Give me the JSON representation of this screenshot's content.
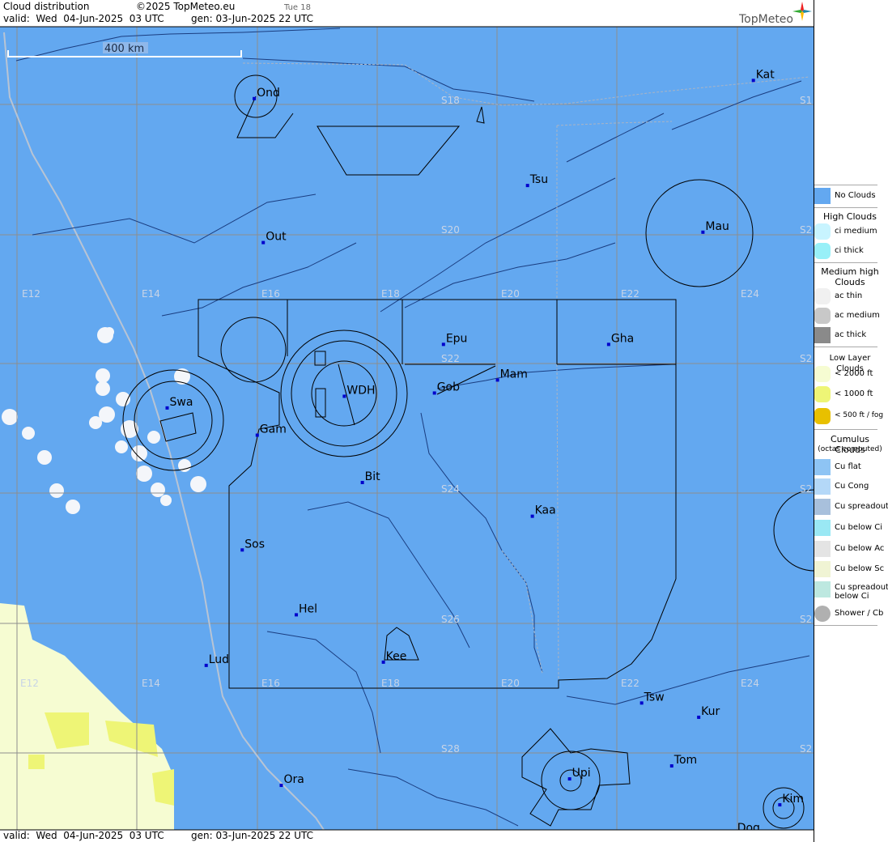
{
  "header": {
    "title": "Cloud distribution",
    "copyright": "©2025 TopMeteo.eu",
    "hour_label": "Tue 18",
    "valid": "valid:  Wed  04-Jun-2025  03 UTC",
    "gen": "gen: 03-Jun-2025 22 UTC",
    "brand": "TopMeteo"
  },
  "footer": {
    "valid": "valid:  Wed  04-Jun-2025  03 UTC",
    "gen": "gen: 03-Jun-2025 22 UTC"
  },
  "scale_label": "400 km",
  "colors": {
    "no_clouds": "#63a8f0",
    "low_cloud": "#f6fcd2",
    "low_cloud_1000": "#eef576",
    "fog": "#e8c000",
    "cumulus": "#f4f6fa",
    "grid": "#8e8e8e",
    "coast": "#b8c4d4"
  },
  "grid_labels": {
    "longitude": [
      "E12",
      "E14",
      "E16",
      "E18",
      "E20",
      "E22",
      "E24"
    ],
    "latitude": [
      "S18",
      "S20",
      "S22",
      "S24",
      "S26",
      "S28"
    ],
    "lat_edge_stubs": [
      "S1",
      "S2",
      "S2",
      "S2",
      "S2",
      "S2"
    ]
  },
  "stations": [
    {
      "code": "Ond",
      "lon": 15.95,
      "lat": -17.91
    },
    {
      "code": "Kat",
      "lon": 24.26,
      "lat": -17.63
    },
    {
      "code": "Tsu",
      "lon": 20.5,
      "lat": -19.25
    },
    {
      "code": "Mau",
      "lon": 23.42,
      "lat": -19.97
    },
    {
      "code": "Out",
      "lon": 16.1,
      "lat": -20.13
    },
    {
      "code": "Epu",
      "lon": 19.1,
      "lat": -21.7
    },
    {
      "code": "Gha",
      "lon": 21.85,
      "lat": -21.7
    },
    {
      "code": "Mam",
      "lon": 20.0,
      "lat": -22.25
    },
    {
      "code": "Gob",
      "lon": 18.95,
      "lat": -22.45
    },
    {
      "code": "WDH",
      "lon": 17.45,
      "lat": -22.5
    },
    {
      "code": "Swa",
      "lon": 14.5,
      "lat": -22.68
    },
    {
      "code": "Gam",
      "lon": 16.0,
      "lat": -23.1
    },
    {
      "code": "Bit",
      "lon": 17.75,
      "lat": -23.83
    },
    {
      "code": "Kaa",
      "lon": 20.58,
      "lat": -24.35
    },
    {
      "code": "Sos",
      "lon": 15.75,
      "lat": -24.87
    },
    {
      "code": "Hel",
      "lon": 16.65,
      "lat": -25.87
    },
    {
      "code": "Lud",
      "lon": 15.15,
      "lat": -26.65
    },
    {
      "code": "Kee",
      "lon": 18.1,
      "lat": -26.6
    },
    {
      "code": "Tsw",
      "lon": 22.4,
      "lat": -27.23
    },
    {
      "code": "Kur",
      "lon": 23.35,
      "lat": -27.45
    },
    {
      "code": "Tom",
      "lon": 22.9,
      "lat": -28.2
    },
    {
      "code": "Upi",
      "lon": 21.2,
      "lat": -28.4
    },
    {
      "code": "Ora",
      "lon": 16.4,
      "lat": -28.5
    },
    {
      "code": "Kim",
      "lon": 24.7,
      "lat": -28.8
    },
    {
      "code": "Dog",
      "lon": 23.95,
      "lat": -29.25
    }
  ],
  "legend": {
    "no_clouds": "No Clouds",
    "high_title": "High Clouds",
    "ci_medium": "ci medium",
    "ci_thick": "ci thick",
    "medium_title": "Medium high Clouds",
    "ac_thin": "ac thin",
    "ac_medium": "ac medium",
    "ac_thick": "ac thick",
    "low_title": "Low Layer Clouds",
    "low_2000": "< 2000 ft",
    "low_1000": "< 1000 ft",
    "low_500": "< 500 ft / fog",
    "cu_title": "Cumulus Clouds",
    "cu_sub": "(octas computed)",
    "cu_flat": "Cu flat",
    "cu_cong": "Cu Cong",
    "cu_spread": "Cu spreadout",
    "cu_below_ci": "Cu below Ci",
    "cu_below_ac": "Cu below Ac",
    "cu_below_sc": "Cu below Sc",
    "cu_spread_ci_1": "Cu spreadout",
    "cu_spread_ci_2": "below Ci",
    "shower": "Shower / Cb"
  }
}
